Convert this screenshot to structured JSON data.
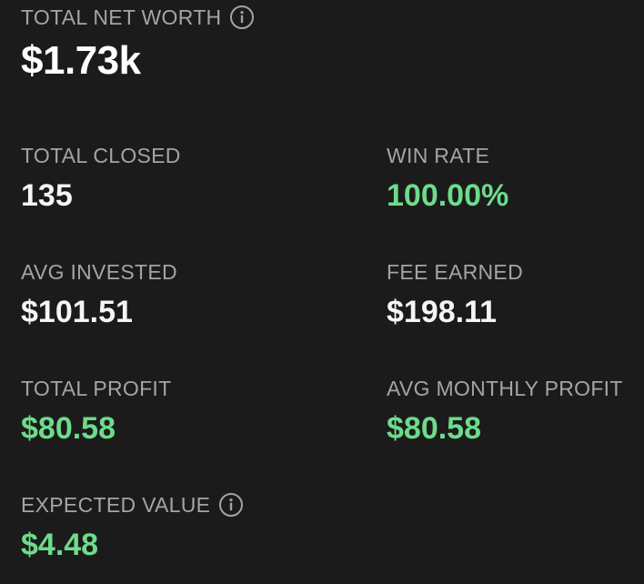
{
  "net_worth": {
    "label": "TOTAL NET WORTH",
    "value": "$1.73k",
    "icon": "info-icon"
  },
  "stats": {
    "total_closed": {
      "label": "TOTAL CLOSED",
      "value": "135"
    },
    "win_rate": {
      "label": "WIN RATE",
      "value": "100.00%"
    },
    "avg_invested": {
      "label": "AVG INVESTED",
      "value": "$101.51"
    },
    "fee_earned": {
      "label": "FEE EARNED",
      "value": "$198.11"
    },
    "total_profit": {
      "label": "TOTAL PROFIT",
      "value": "$80.58"
    },
    "avg_monthly_profit": {
      "label": "AVG MONTHLY PROFIT",
      "value": "$80.58"
    },
    "expected_value": {
      "label": "EXPECTED VALUE",
      "value": "$4.48",
      "icon": "info-icon"
    }
  },
  "colors": {
    "background": "#1b1b1c",
    "label": "#a4a4a8",
    "value": "#f5f5f5",
    "positive": "#6ddc8a"
  }
}
